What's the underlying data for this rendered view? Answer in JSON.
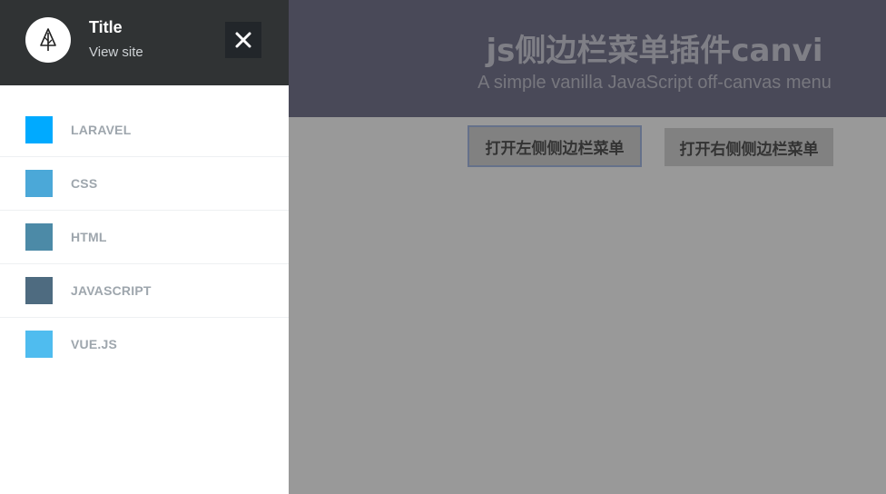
{
  "page": {
    "title": "js侧边栏菜单插件canvi",
    "subtitle": "A simple vanilla JavaScript off-canvas menu",
    "open_left_label": "打开左侧侧边栏菜单",
    "open_right_label": "打开右侧侧边栏菜单"
  },
  "sidebar": {
    "title": "Title",
    "link": "View site",
    "logo_icon": "tree-icon",
    "close_icon": "close-icon",
    "items": [
      {
        "label": "LARAVEL",
        "color": "#00aaff"
      },
      {
        "label": "CSS",
        "color": "#4ba8d8"
      },
      {
        "label": "HTML",
        "color": "#4c8aa7"
      },
      {
        "label": "JAVASCRIPT",
        "color": "#4e6b80"
      },
      {
        "label": "VUE.JS",
        "color": "#4fbcef"
      }
    ]
  },
  "colors": {
    "overlay": "rgba(0,0,0,0.4)",
    "sidebar_header": "#303334",
    "hero": "#7a7a93"
  }
}
